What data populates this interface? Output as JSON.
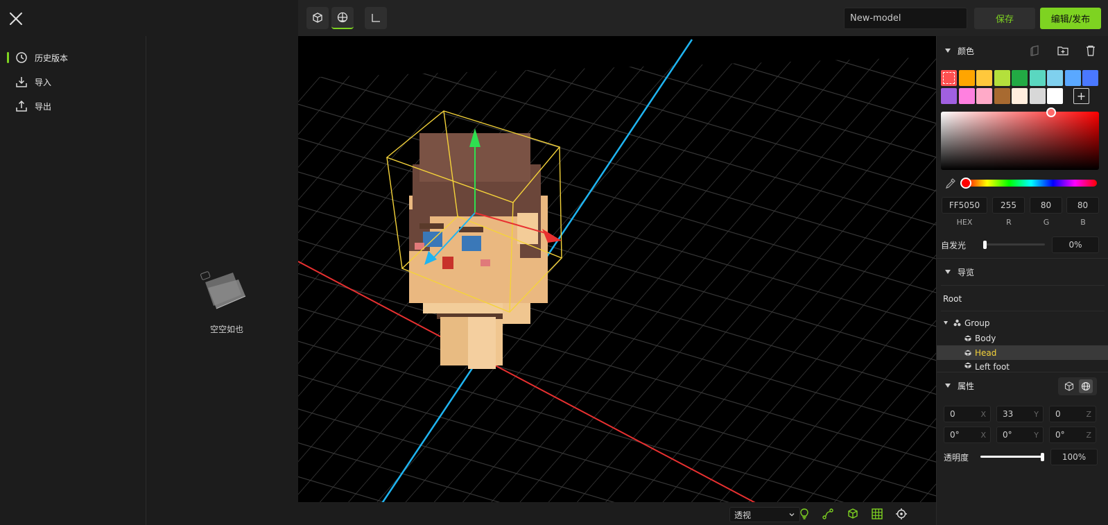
{
  "left_menu": {
    "items": [
      {
        "label": "历史版本",
        "icon": "history-clock-icon",
        "active": true
      },
      {
        "label": "导入",
        "icon": "import-icon",
        "active": false
      },
      {
        "label": "导出",
        "icon": "export-icon",
        "active": false
      }
    ],
    "empty_text": "空空如也"
  },
  "toolbar": {
    "model_name": "New-model",
    "save_label": "保存",
    "publish_label": "编辑/发布"
  },
  "viewport": {
    "view_mode": "透视"
  },
  "color_panel": {
    "title": "颜色",
    "swatches": [
      "#ff5050",
      "#ffa500",
      "#ffc83c",
      "#b4e03c",
      "#22aa44",
      "#5ad7c0",
      "#7fd0ee",
      "#5aa8ff",
      "#4a78ff",
      "#a060e0",
      "#ff80e0",
      "#ffaac8",
      "#a86a30",
      "#ffeedd",
      "#d8d8d8",
      "#ffffff"
    ],
    "add_label": "+",
    "hex": "FF5050",
    "r": "255",
    "g": "80",
    "b": "80",
    "hex_label": "HEX",
    "r_label": "R",
    "g_label": "G",
    "b_label": "B",
    "emissive_label": "自发光",
    "emissive_value": "0%",
    "emissive_level": 0
  },
  "navigator": {
    "title": "导览",
    "root": "Root",
    "group": "Group",
    "children": [
      {
        "label": "Body",
        "selected": false
      },
      {
        "label": "Head",
        "selected": true
      },
      {
        "label": "Left foot",
        "selected": false
      }
    ]
  },
  "properties": {
    "title": "属性",
    "position": [
      {
        "value": "0",
        "axis": "X"
      },
      {
        "value": "33",
        "axis": "Y"
      },
      {
        "value": "0",
        "axis": "Z"
      }
    ],
    "rotation": [
      {
        "value": "0°",
        "axis": "X"
      },
      {
        "value": "0°",
        "axis": "Y"
      },
      {
        "value": "0°",
        "axis": "Z"
      }
    ],
    "opacity_label": "透明度",
    "opacity_value": "100%",
    "opacity_level": 1.0
  }
}
